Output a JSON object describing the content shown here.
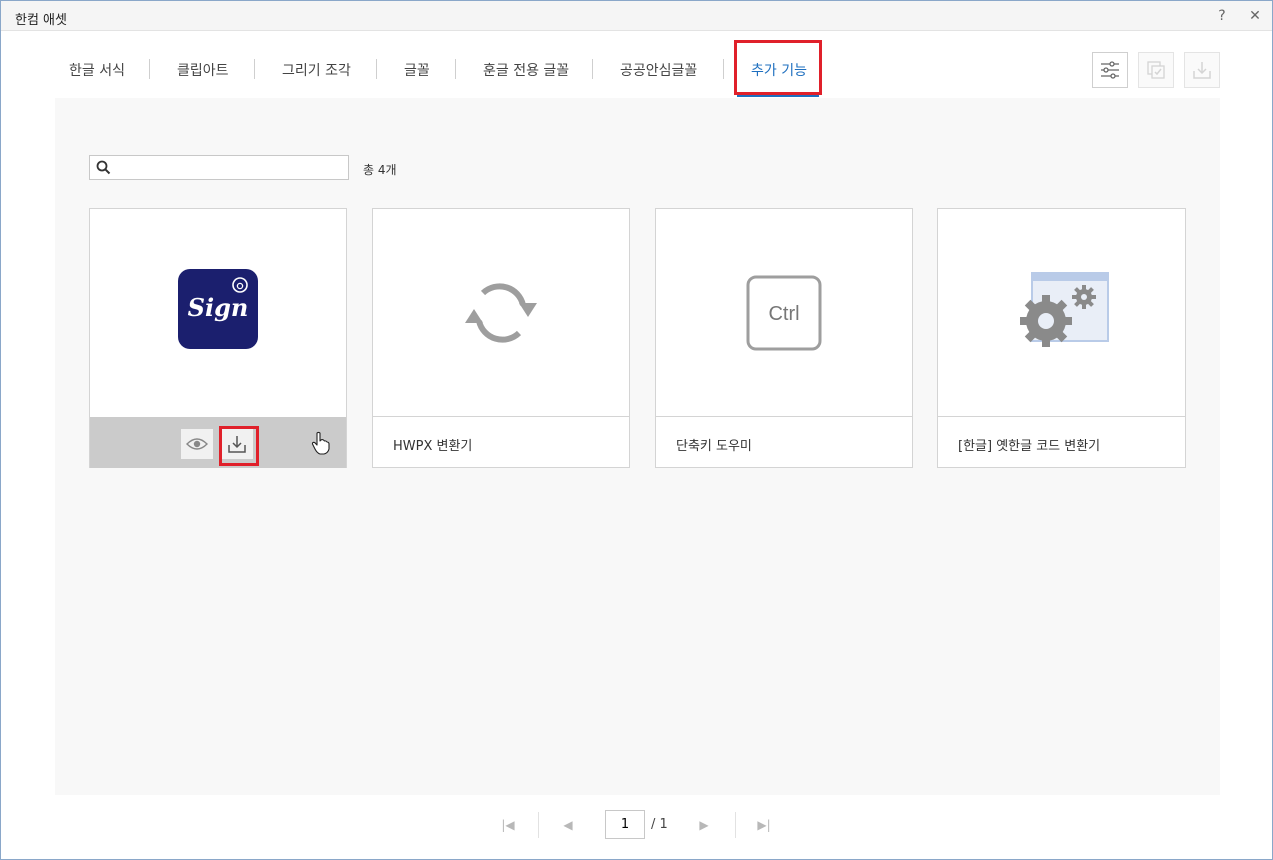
{
  "window": {
    "title": "한컴 애셋",
    "help_label": "?",
    "close_label": "✕"
  },
  "tabs": [
    {
      "label": "한글 서식"
    },
    {
      "label": "클립아트"
    },
    {
      "label": "그리기 조각"
    },
    {
      "label": "글꼴"
    },
    {
      "label": "훈글 전용 글꼴"
    },
    {
      "label": "공공안심글꼴"
    },
    {
      "label": "추가 기능",
      "active": true
    }
  ],
  "toolbar": {
    "filter_icon": "sliders-icon",
    "select_icon": "checked-copy-icon",
    "download_icon": "download-icon"
  },
  "search": {
    "value": "",
    "placeholder": ""
  },
  "count_label": "총 4개",
  "cards": [
    {
      "label": "",
      "icon": "sign-app-icon",
      "icon_text": "Sign"
    },
    {
      "label": "HWPX 변환기",
      "icon": "refresh-arrows-icon"
    },
    {
      "label": "단축키 도우미",
      "icon": "ctrl-key-icon",
      "icon_text": "Ctrl"
    },
    {
      "label": "[한글] 옛한글 코드 변환기",
      "icon": "gear-window-icon"
    }
  ],
  "pager": {
    "current": "1",
    "total": "/ 1"
  },
  "colors": {
    "accent": "#1e6fbf",
    "highlight": "#e0202a",
    "sign_bg": "#1b1f6e"
  }
}
